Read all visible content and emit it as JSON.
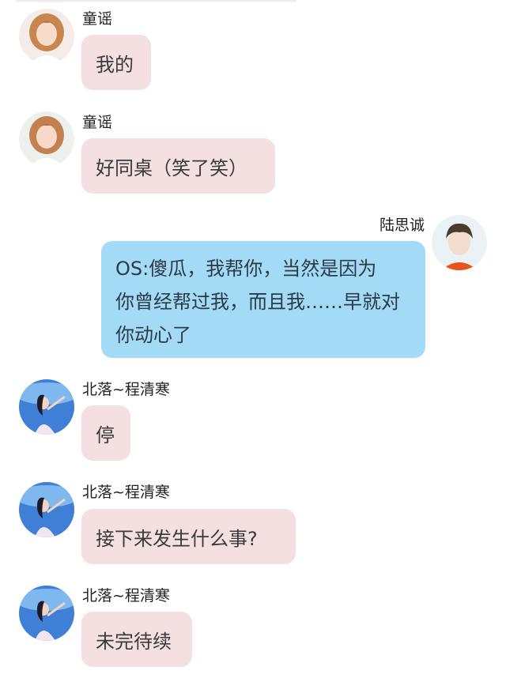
{
  "messages": [
    {
      "sender": "童谣",
      "side": "left",
      "avatar": "girl-avatar-icon",
      "text": "我的"
    },
    {
      "sender": "童谣",
      "side": "left",
      "avatar": "girl-avatar-icon",
      "text": "好同桌（笑了笑）"
    },
    {
      "sender": "陆思诚",
      "side": "right",
      "avatar": "boy-avatar-icon",
      "lines": [
        "OS:傻瓜，我帮你，当然是因为",
        "你曾经帮过我，而且我……早就对",
        "你动心了"
      ]
    },
    {
      "sender": "北落~程清寒",
      "side": "left",
      "avatar": "dancer-avatar-icon",
      "text": "停"
    },
    {
      "sender": "北落~程清寒",
      "side": "left",
      "avatar": "dancer-avatar-icon",
      "text": "接下来发生什么事?"
    },
    {
      "sender": "北落~程清寒",
      "side": "left",
      "avatar": "dancer-avatar-icon",
      "text": "未完待续"
    }
  ],
  "colors": {
    "incoming_bubble": "#f5e0e1",
    "outgoing_bubble": "#a3dbf7",
    "background": "#ffffff"
  }
}
